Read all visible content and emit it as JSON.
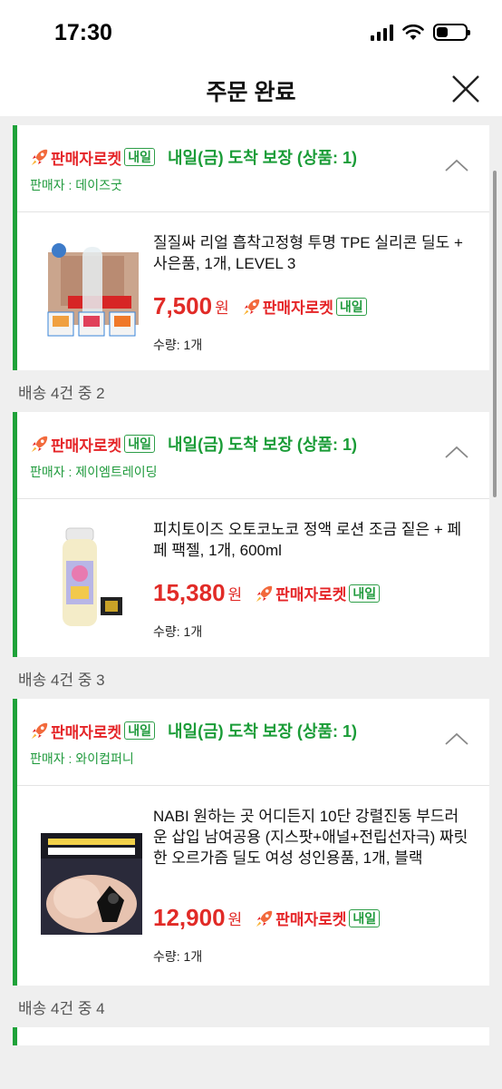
{
  "status": {
    "time": "17:30"
  },
  "header": {
    "title": "주문 완료"
  },
  "badge": {
    "rocket_label": "판매자로켓",
    "tomorrow_label": "내일"
  },
  "shipments": [
    {
      "section_label": "",
      "arrival": "내일(금) 도착 보장 (상품: 1)",
      "seller": "판매자 : 데이즈굿",
      "item": {
        "name": "질질싸 리얼 흡착고정형 투명 TPE 실리콘 딜도 + 사은품, 1개, LEVEL 3",
        "price": "7,500",
        "currency": "원",
        "quantity": "수량: 1개"
      }
    },
    {
      "section_label": "배송 4건 중 2",
      "arrival": "내일(금) 도착 보장 (상품: 1)",
      "seller": "판매자 : 제이엠트레이딩",
      "item": {
        "name": "피치토이즈 오토코노코 정액 로션 조금 짙은 + 페페 팩젤, 1개, 600ml",
        "price": "15,380",
        "currency": "원",
        "quantity": "수량: 1개"
      }
    },
    {
      "section_label": "배송 4건 중 3",
      "arrival": "내일(금) 도착 보장 (상품: 1)",
      "seller": "판매자 : 와이컴퍼니",
      "item": {
        "name": "NABI 원하는 곳 어디든지 10단 강렬진동 부드러운 삽입 남여공용 (지스팟+애널+전립선자극) 짜릿한 오르가즘 딜도 여성 성인용품, 1개, 블랙",
        "price": "12,900",
        "currency": "원",
        "quantity": "수량: 1개"
      }
    }
  ],
  "next_section_label": "배송 4건 중 4",
  "colors": {
    "accent_green": "#1fa23a",
    "price_red": "#e12b27",
    "rocket_red": "#e52528"
  }
}
